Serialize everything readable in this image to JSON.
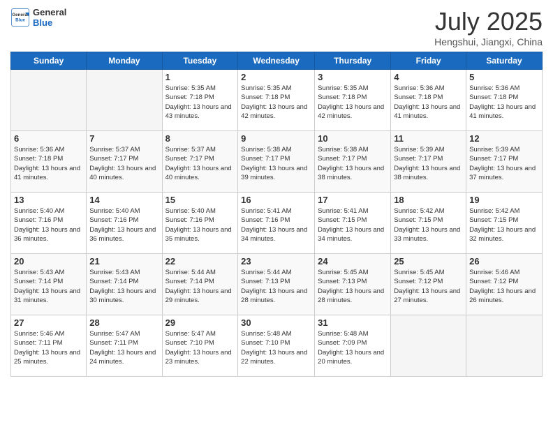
{
  "header": {
    "logo_general": "General",
    "logo_blue": "Blue",
    "month_title": "July 2025",
    "location": "Hengshui, Jiangxi, China"
  },
  "weekdays": [
    "Sunday",
    "Monday",
    "Tuesday",
    "Wednesday",
    "Thursday",
    "Friday",
    "Saturday"
  ],
  "weeks": [
    [
      {
        "day": "",
        "info": ""
      },
      {
        "day": "",
        "info": ""
      },
      {
        "day": "1",
        "info": "Sunrise: 5:35 AM\nSunset: 7:18 PM\nDaylight: 13 hours and 43 minutes."
      },
      {
        "day": "2",
        "info": "Sunrise: 5:35 AM\nSunset: 7:18 PM\nDaylight: 13 hours and 42 minutes."
      },
      {
        "day": "3",
        "info": "Sunrise: 5:35 AM\nSunset: 7:18 PM\nDaylight: 13 hours and 42 minutes."
      },
      {
        "day": "4",
        "info": "Sunrise: 5:36 AM\nSunset: 7:18 PM\nDaylight: 13 hours and 41 minutes."
      },
      {
        "day": "5",
        "info": "Sunrise: 5:36 AM\nSunset: 7:18 PM\nDaylight: 13 hours and 41 minutes."
      }
    ],
    [
      {
        "day": "6",
        "info": "Sunrise: 5:36 AM\nSunset: 7:18 PM\nDaylight: 13 hours and 41 minutes."
      },
      {
        "day": "7",
        "info": "Sunrise: 5:37 AM\nSunset: 7:17 PM\nDaylight: 13 hours and 40 minutes."
      },
      {
        "day": "8",
        "info": "Sunrise: 5:37 AM\nSunset: 7:17 PM\nDaylight: 13 hours and 40 minutes."
      },
      {
        "day": "9",
        "info": "Sunrise: 5:38 AM\nSunset: 7:17 PM\nDaylight: 13 hours and 39 minutes."
      },
      {
        "day": "10",
        "info": "Sunrise: 5:38 AM\nSunset: 7:17 PM\nDaylight: 13 hours and 38 minutes."
      },
      {
        "day": "11",
        "info": "Sunrise: 5:39 AM\nSunset: 7:17 PM\nDaylight: 13 hours and 38 minutes."
      },
      {
        "day": "12",
        "info": "Sunrise: 5:39 AM\nSunset: 7:17 PM\nDaylight: 13 hours and 37 minutes."
      }
    ],
    [
      {
        "day": "13",
        "info": "Sunrise: 5:40 AM\nSunset: 7:16 PM\nDaylight: 13 hours and 36 minutes."
      },
      {
        "day": "14",
        "info": "Sunrise: 5:40 AM\nSunset: 7:16 PM\nDaylight: 13 hours and 36 minutes."
      },
      {
        "day": "15",
        "info": "Sunrise: 5:40 AM\nSunset: 7:16 PM\nDaylight: 13 hours and 35 minutes."
      },
      {
        "day": "16",
        "info": "Sunrise: 5:41 AM\nSunset: 7:16 PM\nDaylight: 13 hours and 34 minutes."
      },
      {
        "day": "17",
        "info": "Sunrise: 5:41 AM\nSunset: 7:15 PM\nDaylight: 13 hours and 34 minutes."
      },
      {
        "day": "18",
        "info": "Sunrise: 5:42 AM\nSunset: 7:15 PM\nDaylight: 13 hours and 33 minutes."
      },
      {
        "day": "19",
        "info": "Sunrise: 5:42 AM\nSunset: 7:15 PM\nDaylight: 13 hours and 32 minutes."
      }
    ],
    [
      {
        "day": "20",
        "info": "Sunrise: 5:43 AM\nSunset: 7:14 PM\nDaylight: 13 hours and 31 minutes."
      },
      {
        "day": "21",
        "info": "Sunrise: 5:43 AM\nSunset: 7:14 PM\nDaylight: 13 hours and 30 minutes."
      },
      {
        "day": "22",
        "info": "Sunrise: 5:44 AM\nSunset: 7:14 PM\nDaylight: 13 hours and 29 minutes."
      },
      {
        "day": "23",
        "info": "Sunrise: 5:44 AM\nSunset: 7:13 PM\nDaylight: 13 hours and 28 minutes."
      },
      {
        "day": "24",
        "info": "Sunrise: 5:45 AM\nSunset: 7:13 PM\nDaylight: 13 hours and 28 minutes."
      },
      {
        "day": "25",
        "info": "Sunrise: 5:45 AM\nSunset: 7:12 PM\nDaylight: 13 hours and 27 minutes."
      },
      {
        "day": "26",
        "info": "Sunrise: 5:46 AM\nSunset: 7:12 PM\nDaylight: 13 hours and 26 minutes."
      }
    ],
    [
      {
        "day": "27",
        "info": "Sunrise: 5:46 AM\nSunset: 7:11 PM\nDaylight: 13 hours and 25 minutes."
      },
      {
        "day": "28",
        "info": "Sunrise: 5:47 AM\nSunset: 7:11 PM\nDaylight: 13 hours and 24 minutes."
      },
      {
        "day": "29",
        "info": "Sunrise: 5:47 AM\nSunset: 7:10 PM\nDaylight: 13 hours and 23 minutes."
      },
      {
        "day": "30",
        "info": "Sunrise: 5:48 AM\nSunset: 7:10 PM\nDaylight: 13 hours and 22 minutes."
      },
      {
        "day": "31",
        "info": "Sunrise: 5:48 AM\nSunset: 7:09 PM\nDaylight: 13 hours and 20 minutes."
      },
      {
        "day": "",
        "info": ""
      },
      {
        "day": "",
        "info": ""
      }
    ]
  ]
}
